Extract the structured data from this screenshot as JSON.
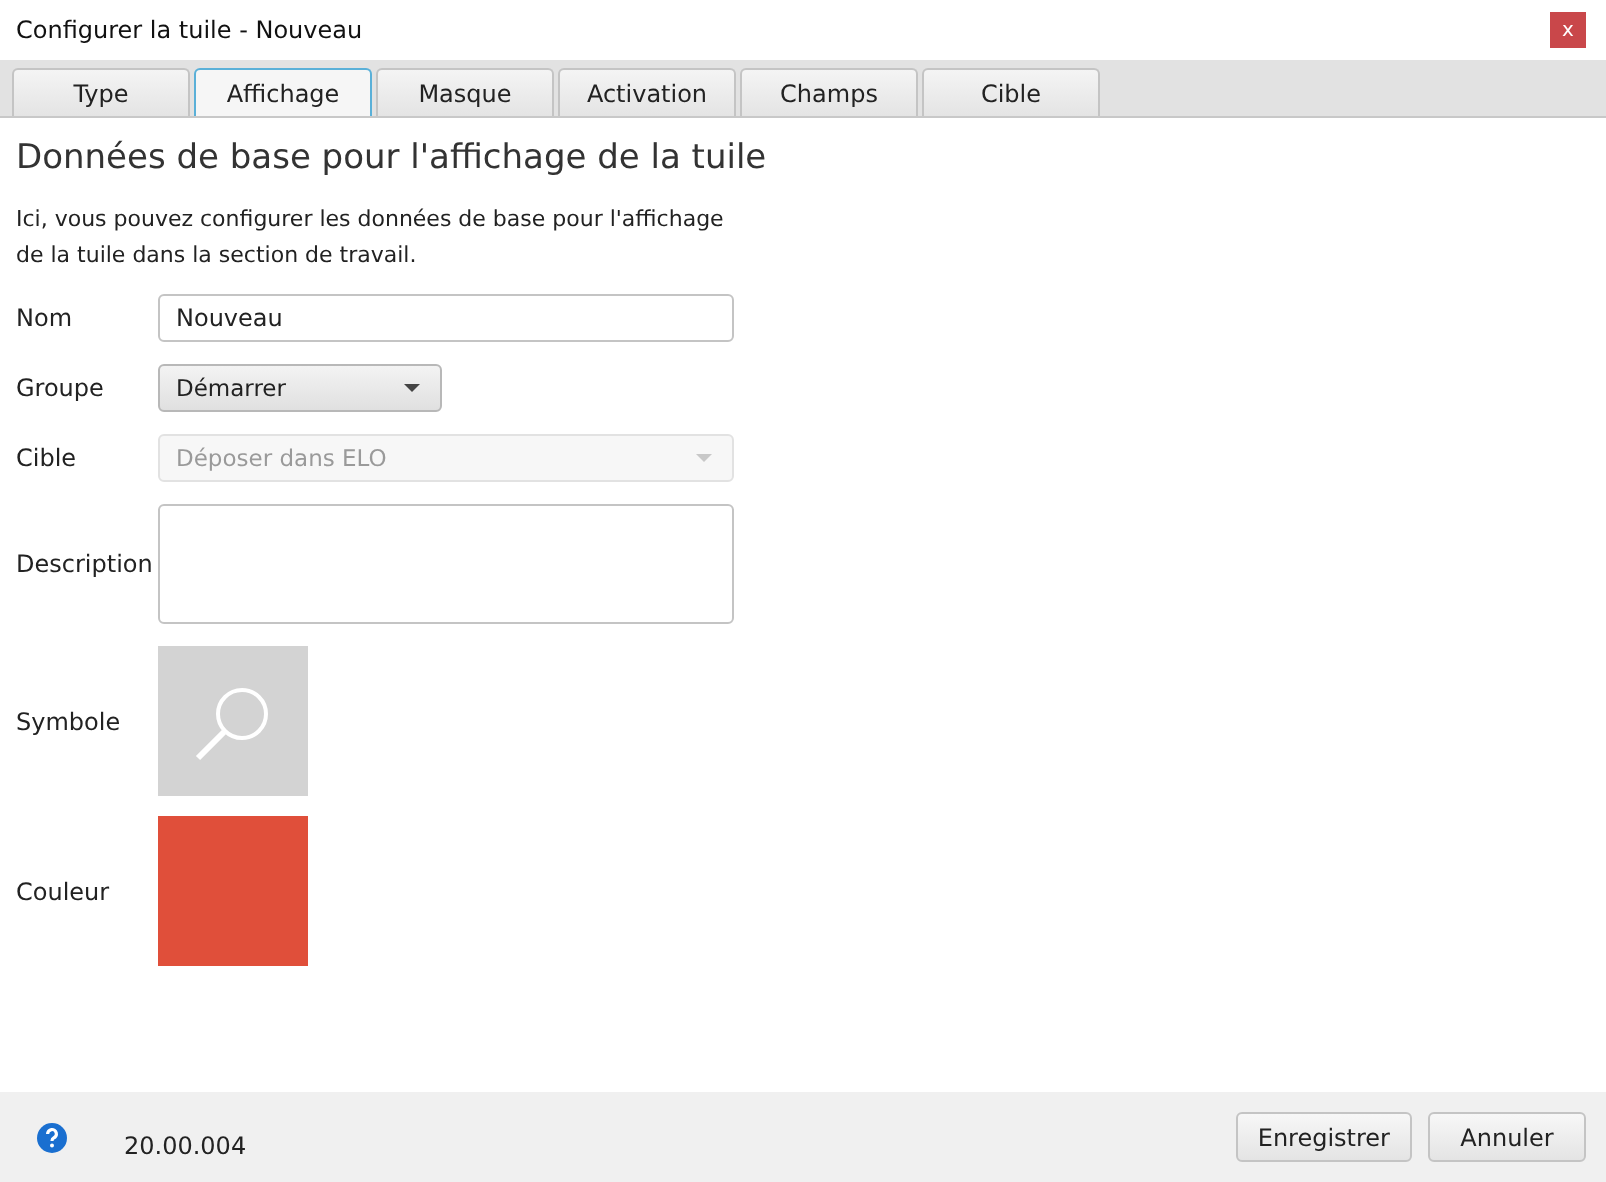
{
  "window": {
    "title": "Configurer la tuile - Nouveau",
    "close": "x"
  },
  "tabs": [
    {
      "label": "Type",
      "selected": false
    },
    {
      "label": "Affichage",
      "selected": true
    },
    {
      "label": "Masque",
      "selected": false
    },
    {
      "label": "Activation",
      "selected": false
    },
    {
      "label": "Champs",
      "selected": false
    },
    {
      "label": "Cible",
      "selected": false
    }
  ],
  "heading": "Données de base pour l'affichage de la tuile",
  "intro": "Ici, vous pouvez configurer les données de base pour l'affichage de la tuile dans la section de travail.",
  "fields": [
    {
      "kind": "text",
      "label": "Nom",
      "value": "Nouveau"
    },
    {
      "kind": "dropdown",
      "label": "Groupe",
      "value": "Démarrer",
      "disabled": false
    },
    {
      "kind": "dropdown",
      "label": "Cible",
      "value": "Déposer dans ELO",
      "disabled": true
    },
    {
      "kind": "textarea",
      "label": "Description"
    },
    {
      "kind": "symbol",
      "label": "Symbole"
    },
    {
      "kind": "color",
      "label": "Couleur",
      "color": "#e04f3a"
    }
  ],
  "footer": {
    "version": "20.00.004",
    "buttons": [
      "Enregistrer",
      "Annuler"
    ]
  }
}
